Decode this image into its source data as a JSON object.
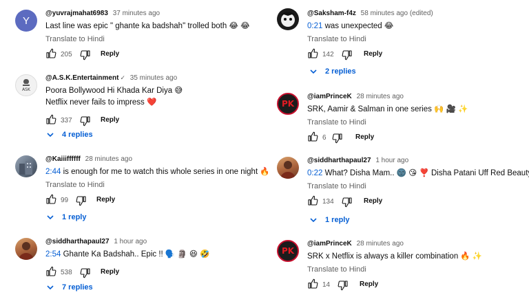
{
  "left": [
    {
      "author": "@yuvrajmahat6983",
      "time": "37 minutes ago",
      "text": "Last line was epic \" ghante ka badshah\" trolled both 😂 😂",
      "translate": "Translate to Hindi",
      "likes": "205",
      "reply": "Reply",
      "avatar_letter": "Y",
      "avatar_color": "#5c6bc0"
    },
    {
      "author": "@A.S.K.Entertainment",
      "check": "✓",
      "time": "35 minutes ago",
      "text_line1": "Poora Bollywood Hi Khada Kar Diya 😅",
      "text_line2": "Netflix never fails to impress ❤️",
      "likes": "337",
      "reply": "Reply",
      "replies": "4 replies"
    },
    {
      "author": "@Kaiiiffffff",
      "time": "28 minutes ago",
      "timestamp": "2:44",
      "text": " is enough for me to watch this whole series in one night 🔥",
      "translate": "Translate to Hindi",
      "likes": "99",
      "reply": "Reply",
      "replies": "1 reply"
    },
    {
      "author": "@siddharthapaul27",
      "time": "1 hour ago",
      "timestamp": "2:54",
      "text": " Ghante Ka Badshah.. Epic !! 🗣️ 🗿 😆 🤣",
      "likes": "538",
      "reply": "Reply",
      "replies": "7 replies"
    }
  ],
  "right": [
    {
      "author": "@Saksham-f4z",
      "time": "58 minutes ago (edited)",
      "timestamp": "0:21",
      "text": " was unexpected 😂",
      "translate": "Translate to Hindi",
      "likes": "142",
      "reply": "Reply",
      "replies": "2 replies"
    },
    {
      "author": "@iamPrinceK",
      "time": "28 minutes ago",
      "text": "SRK, Aamir & Salman in one series 🙌 🎥 ✨",
      "translate": "Translate to Hindi",
      "likes": "6",
      "reply": "Reply",
      "avatar_letters": "PK"
    },
    {
      "author": "@siddharthapaul27",
      "time": "1 hour ago",
      "timestamp": "0:22",
      "text": " What? Disha Mam.. 🌚 😘 ❣️ Disha Patani Uff Red Beauty! 🔥",
      "translate": "Translate to Hindi",
      "likes": "134",
      "reply": "Reply",
      "replies": "1 reply"
    },
    {
      "author": "@iamPrinceK",
      "time": "28 minutes ago",
      "text": "SRK x Netflix is always a killer combination 🔥 ✨",
      "translate": "Translate to Hindi",
      "likes": "14",
      "reply": "Reply",
      "avatar_letters": "PK"
    }
  ]
}
